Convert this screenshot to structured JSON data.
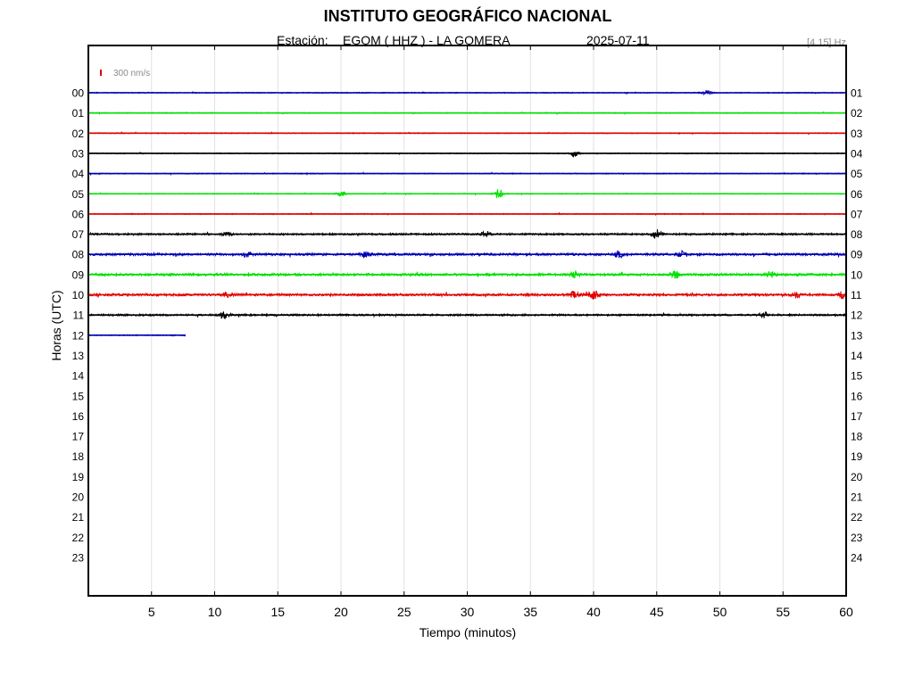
{
  "header": {
    "title": "INSTITUTO GEOGRÁFICO NACIONAL",
    "station_label": "Estación:",
    "station": "EGOM ( HHZ ) - LA GOMERA",
    "date": "2025-07-11",
    "band": "[4 15] Hz"
  },
  "chart_data": {
    "type": "line",
    "title": "INSTITUTO GEOGRÁFICO NACIONAL",
    "xlabel": "Tiempo (minutos)",
    "ylabel": "Horas (UTC)",
    "xlim": [
      0,
      60
    ],
    "xticks": [
      5,
      10,
      15,
      20,
      25,
      30,
      35,
      40,
      45,
      50,
      55,
      60
    ],
    "left_hours": [
      "00",
      "01",
      "02",
      "03",
      "04",
      "05",
      "06",
      "07",
      "08",
      "09",
      "10",
      "11",
      "12",
      "13",
      "14",
      "15",
      "16",
      "17",
      "18",
      "19",
      "20",
      "21",
      "22",
      "23"
    ],
    "right_hours": [
      "01",
      "02",
      "03",
      "04",
      "05",
      "06",
      "07",
      "08",
      "09",
      "10",
      "11",
      "12",
      "13",
      "14",
      "15",
      "16",
      "17",
      "18",
      "19",
      "20",
      "21",
      "22",
      "23",
      "24"
    ],
    "scale_label": "300 nm/s",
    "grid": "vertical",
    "colors": [
      "#0000b4",
      "#00e000",
      "#e00000",
      "#000000"
    ],
    "scale_color": "#e00000",
    "series": [
      {
        "hour": "00",
        "end_minute": 60,
        "amplitude": 1.0,
        "bursts": [
          {
            "t": 49,
            "a": 2.5
          }
        ]
      },
      {
        "hour": "01",
        "end_minute": 60,
        "amplitude": 1.0,
        "bursts": []
      },
      {
        "hour": "02",
        "end_minute": 60,
        "amplitude": 1.0,
        "bursts": []
      },
      {
        "hour": "03",
        "end_minute": 60,
        "amplitude": 1.0,
        "bursts": [
          {
            "t": 38.5,
            "a": 3.5
          }
        ]
      },
      {
        "hour": "04",
        "end_minute": 60,
        "amplitude": 1.0,
        "bursts": []
      },
      {
        "hour": "05",
        "end_minute": 60,
        "amplitude": 1.0,
        "bursts": [
          {
            "t": 20,
            "a": 3
          },
          {
            "t": 32.5,
            "a": 6
          }
        ]
      },
      {
        "hour": "06",
        "end_minute": 60,
        "amplitude": 1.0,
        "bursts": []
      },
      {
        "hour": "07",
        "end_minute": 60,
        "amplitude": 2.0,
        "bursts": [
          {
            "t": 31.5,
            "a": 3
          },
          {
            "t": 45,
            "a": 5
          },
          {
            "t": 11,
            "a": 2.5
          }
        ]
      },
      {
        "hour": "08",
        "end_minute": 60,
        "amplitude": 2.5,
        "bursts": [
          {
            "t": 22,
            "a": 4
          },
          {
            "t": 42,
            "a": 3.5
          },
          {
            "t": 12.5,
            "a": 3
          },
          {
            "t": 47,
            "a": 3
          }
        ]
      },
      {
        "hour": "09",
        "end_minute": 60,
        "amplitude": 2.5,
        "bursts": [
          {
            "t": 38.5,
            "a": 4
          },
          {
            "t": 46.5,
            "a": 3.5
          },
          {
            "t": 54,
            "a": 3
          }
        ]
      },
      {
        "hour": "10",
        "end_minute": 60,
        "amplitude": 2.5,
        "bursts": [
          {
            "t": 11,
            "a": 3
          },
          {
            "t": 38.5,
            "a": 4
          },
          {
            "t": 40,
            "a": 5
          },
          {
            "t": 56,
            "a": 3
          },
          {
            "t": 59.8,
            "a": 4
          }
        ]
      },
      {
        "hour": "11",
        "end_minute": 60,
        "amplitude": 2.0,
        "bursts": [
          {
            "t": 10.8,
            "a": 4.5
          },
          {
            "t": 53.5,
            "a": 3
          }
        ]
      },
      {
        "hour": "12",
        "end_minute": 7.7,
        "amplitude": 1.2,
        "bursts": []
      }
    ]
  }
}
